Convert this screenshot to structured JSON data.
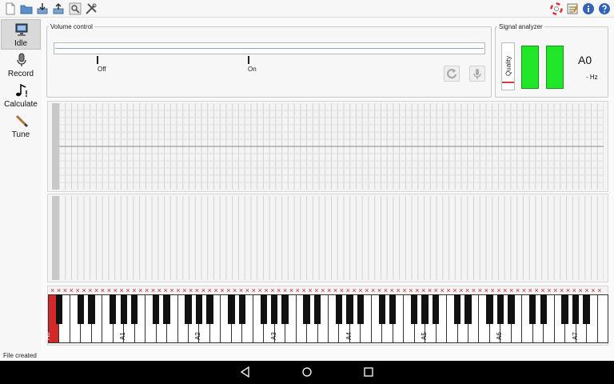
{
  "colors": {
    "accent_green": "#22e62a",
    "active_key": "#d42828",
    "mark_red": "#cc2222",
    "nav_bg": "#000000"
  },
  "toolbar": {
    "left_icons": [
      "new-document-icon",
      "open-folder-icon",
      "save-icon",
      "export-icon",
      "search-icon",
      "tools-icon"
    ],
    "right_icons": [
      "help-ring-icon",
      "notes-icon",
      "info-icon",
      "help-question-icon"
    ]
  },
  "sidebar": {
    "modes": [
      {
        "label": "Idle",
        "icon": "monitor-icon",
        "active": true
      },
      {
        "label": "Record",
        "icon": "microphone-icon",
        "active": false
      },
      {
        "label": "Calculate",
        "icon": "music-note-icon",
        "active": false
      },
      {
        "label": "Tune",
        "icon": "tuning-hammer-icon",
        "active": false
      }
    ]
  },
  "volume": {
    "title": "Volume control",
    "off_label": "Off",
    "on_label": "On",
    "buttons": [
      "refresh-icon",
      "mic-icon"
    ]
  },
  "analyzer": {
    "title": "Signal analyzer",
    "quality_label": "Quality",
    "note": "A0",
    "frequency": "- Hz"
  },
  "keyboard": {
    "octave_labels": [
      "A0",
      "A1",
      "A2",
      "A3",
      "A4",
      "A5",
      "A6",
      "A7"
    ],
    "white_keys": 52,
    "active_key": "A0"
  },
  "status": {
    "text": "File created"
  },
  "navbar": {
    "buttons": [
      "back-icon",
      "home-icon",
      "recents-icon"
    ]
  }
}
